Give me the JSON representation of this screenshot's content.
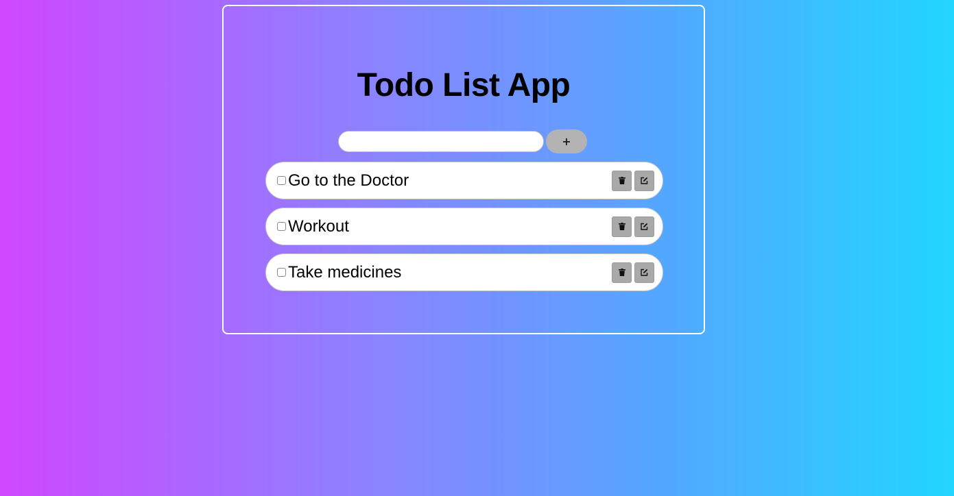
{
  "app": {
    "title": "Todo List App"
  },
  "add_form": {
    "input_value": "",
    "input_placeholder": "",
    "add_button_icon": "plus-icon",
    "add_button_label": "+"
  },
  "todos": [
    {
      "text": "Go to the Doctor",
      "checked": false
    },
    {
      "text": "Workout",
      "checked": false
    },
    {
      "text": "Take medicines",
      "checked": false
    }
  ],
  "item_actions": {
    "delete_icon": "trash-icon",
    "edit_icon": "edit-icon"
  },
  "colors": {
    "gradient_start": "#cf47ff",
    "gradient_end": "#22d6ff",
    "button_gray": "#a9a9a9",
    "add_button_gray": "#b3b3b3"
  }
}
